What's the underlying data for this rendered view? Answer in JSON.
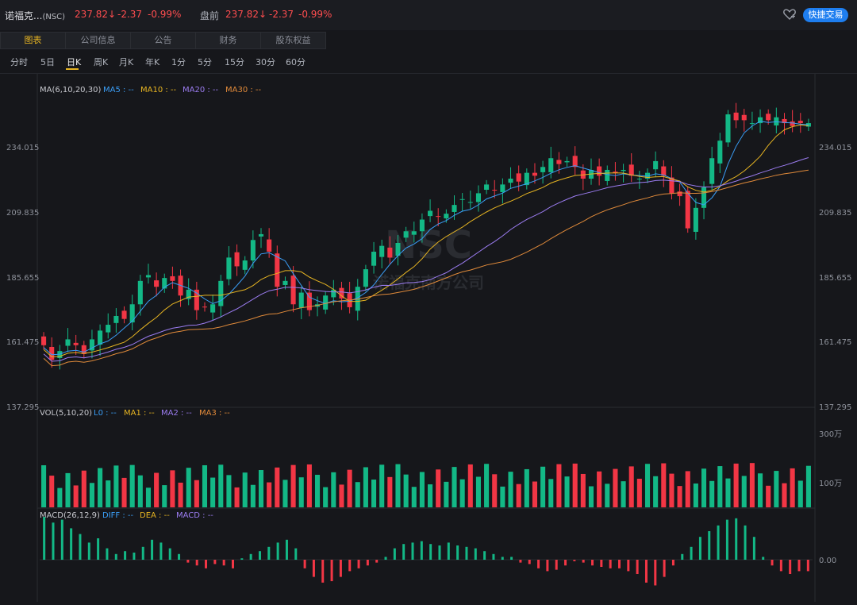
{
  "header": {
    "title": "诺福克...",
    "ticker": "(NSC)",
    "price": "237.82",
    "change": "-2.37",
    "change_pct": "-0.99%",
    "premarket_label": "盘前",
    "premarket_price": "237.82",
    "premarket_change": "-2.37",
    "premarket_change_pct": "-0.99%",
    "quick_trade": "快捷交易",
    "favorite_icon": "heart-outline-icon",
    "down_arrow": "↓",
    "color_down": "#ff4d4f"
  },
  "tabs": [
    "图表",
    "公司信息",
    "公告",
    "财务",
    "股东权益"
  ],
  "active_tab": "图表",
  "periods": [
    "分时",
    "5日",
    "日K",
    "周K",
    "月K",
    "年K",
    "1分",
    "5分",
    "15分",
    "30分",
    "60分"
  ],
  "active_period": "日K",
  "panels": {
    "ma_label": "MA(6,10,20,30)",
    "ma_items": [
      "MA5 : --",
      "MA10 : --",
      "MA20 : --",
      "MA30 : --"
    ],
    "vol_label": "VOL(5,10,20)",
    "vol_items": [
      "L0 : --",
      "MA1 : --",
      "MA2 : --",
      "MA3 : --"
    ],
    "macd_label": "MACD(26,12,9)",
    "macd_items": [
      "DIFF : --",
      "DEA : --",
      "MACD : --"
    ],
    "colors": {
      "ma5": "#3a9df5",
      "ma10": "#e6b422",
      "ma20": "#9b7cf0",
      "ma30": "#e08a3a",
      "up": "#f23645",
      "down": "#13b886",
      "panel_label": "#c8c9cf"
    }
  },
  "price_axis": {
    "ticks": [
      "234.015",
      "209.835",
      "185.655",
      "161.475",
      "137.295"
    ]
  },
  "volume_axis": {
    "ticks": [
      "300万",
      "100万"
    ]
  },
  "macd_axis": {
    "ticks": [
      "0.00"
    ]
  },
  "watermark": {
    "symbol": "NSC",
    "name": "诺福克南方公司"
  },
  "chart_data": {
    "type": "candlestick",
    "price_range": [
      137.295,
      240.0
    ],
    "close_series": [
      158,
      153,
      156,
      160,
      158,
      155,
      160,
      163,
      165,
      168,
      167,
      172,
      180,
      182,
      178,
      181,
      180,
      175,
      177,
      170,
      171,
      172,
      180,
      188,
      185,
      187,
      194,
      196,
      190,
      178,
      180,
      172,
      176,
      170,
      172,
      175,
      177,
      174,
      171,
      178,
      184,
      190,
      192,
      188,
      193,
      197,
      197,
      201,
      204,
      202,
      203,
      206,
      208,
      207,
      210,
      213,
      211,
      213,
      215,
      214,
      217,
      216,
      219,
      222,
      220,
      221,
      219,
      215,
      218,
      216,
      218,
      217,
      218,
      216,
      215,
      217,
      221,
      216,
      210,
      209,
      198,
      205,
      212,
      222,
      228,
      237,
      235,
      235,
      234,
      236,
      235,
      236,
      234,
      233,
      234,
      234
    ],
    "volume_scale_max": 300,
    "macd_series": [
      3.0,
      2.6,
      2.8,
      2.2,
      1.8,
      1.2,
      1.5,
      0.8,
      0.4,
      0.6,
      0.5,
      0.9,
      1.4,
      1.2,
      0.8,
      0.4,
      -0.2,
      -0.4,
      -0.6,
      -0.3,
      -0.4,
      -0.6,
      0.1,
      0.4,
      0.6,
      0.9,
      1.2,
      1.4,
      0.8,
      -0.6,
      -1.2,
      -1.6,
      -1.5,
      -1.2,
      -0.8,
      -0.6,
      -0.4,
      -0.2,
      0.2,
      0.8,
      1.1,
      1.2,
      1.3,
      1.1,
      1.0,
      1.2,
      1.0,
      0.9,
      0.8,
      0.6,
      0.4,
      0.2,
      0.2,
      -0.2,
      -0.3,
      -0.6,
      -0.8,
      -0.7,
      -0.4,
      -0.1,
      -0.2,
      -0.4,
      -0.5,
      -0.6,
      -0.6,
      -0.8,
      -1.0,
      -1.6,
      -1.8,
      -1.2,
      -0.4,
      0.4,
      0.9,
      1.6,
      2.0,
      2.4,
      2.8,
      2.9,
      2.4,
      1.6,
      0.2,
      -0.4,
      -0.8,
      -1.0,
      -0.8,
      -0.8
    ]
  }
}
